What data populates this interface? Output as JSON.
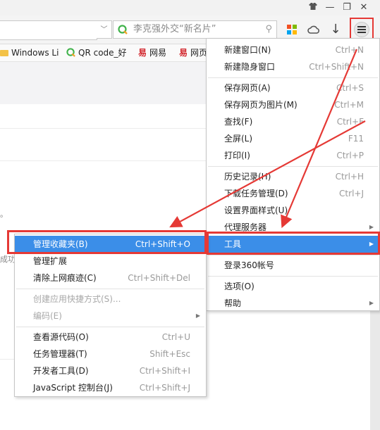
{
  "colors": {
    "accent": "#3b8ee8",
    "annotation": "#e53935",
    "menu_bg": "#ffffff",
    "toolbar_bg": "#f4f4f4"
  },
  "titlebar": {
    "icons": [
      "shirt-icon",
      "minimize-icon",
      "restore-icon",
      "close-icon"
    ],
    "min": "—",
    "max": "❐",
    "close": "✕"
  },
  "toolbar": {
    "search_placeholder": "李克强外交“新名片”",
    "url_dropdown": "﹀",
    "search_icon": "⚲",
    "icons": [
      "apps-grid-icon",
      "cloud-icon",
      "download-icon",
      "menu-icon"
    ],
    "download": "↓"
  },
  "bookmarks": [
    {
      "label": "Windows Li",
      "icon": "folder-icon"
    },
    {
      "label": "QR code_好",
      "icon": "search-q-icon"
    },
    {
      "label": "网易",
      "icon": "360-icon"
    },
    {
      "label": "网页",
      "icon": "360-icon"
    }
  ],
  "bookmark_360_glyph": "易",
  "page": {
    "cut_text_1": "。",
    "cut_text_2": "成功"
  },
  "main_menu": {
    "items": [
      {
        "label": "新建窗口(N)",
        "shortcut": "Ctrl+N"
      },
      {
        "label": "新建隐身窗口",
        "shortcut": "Ctrl+Shift+N"
      },
      {
        "label": "保存网页(A)",
        "shortcut": "Ctrl+S"
      },
      {
        "label": "保存网页为图片(M)",
        "shortcut": "Ctrl+M"
      },
      {
        "label": "查找(F)",
        "shortcut": "Ctrl+F"
      },
      {
        "label": "全屏(L)",
        "shortcut": "F11"
      },
      {
        "label": "打印(I)",
        "shortcut": "Ctrl+P"
      },
      {
        "label": "历史记录(H)",
        "shortcut": "Ctrl+H"
      },
      {
        "label": "下载任务管理(D)",
        "shortcut": "Ctrl+J"
      },
      {
        "label": "设置界面样式(U)",
        "shortcut": ""
      },
      {
        "label": "代理服务器",
        "shortcut": "",
        "submenu": true
      },
      {
        "label": "工具",
        "shortcut": "",
        "submenu": true,
        "highlighted": true
      },
      {
        "label": "登录360帐号",
        "shortcut": ""
      },
      {
        "label": "选项(O)",
        "shortcut": ""
      },
      {
        "label": "帮助",
        "shortcut": "",
        "submenu": true
      }
    ]
  },
  "tools_menu": {
    "items": [
      {
        "label": "管理收藏夹(B)",
        "shortcut": "Ctrl+Shift+O",
        "highlighted": true
      },
      {
        "label": "管理扩展",
        "shortcut": ""
      },
      {
        "label": "清除上网痕迹(C)",
        "shortcut": "Ctrl+Shift+Del"
      },
      {
        "label": "创建应用快捷方式(S)...",
        "shortcut": "",
        "disabled": true
      },
      {
        "label": "编码(E)",
        "shortcut": "",
        "disabled": true,
        "submenu": true
      },
      {
        "label": "查看源代码(O)",
        "shortcut": "Ctrl+U"
      },
      {
        "label": "任务管理器(T)",
        "shortcut": "Shift+Esc"
      },
      {
        "label": "开发者工具(D)",
        "shortcut": "Ctrl+Shift+I"
      },
      {
        "label": "JavaScript 控制台(J)",
        "shortcut": "Ctrl+Shift+J"
      }
    ]
  },
  "submenu_arrow": "▶"
}
